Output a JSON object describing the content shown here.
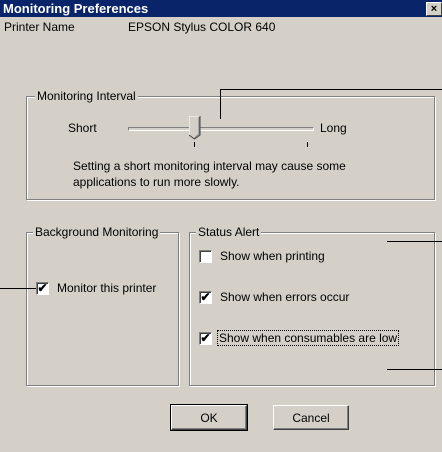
{
  "window": {
    "title": "Monitoring Preferences",
    "close_label": "×"
  },
  "printer": {
    "label": "Printer Name",
    "name": "EPSON Stylus COLOR 640"
  },
  "monitoring_interval": {
    "legend": "Monitoring Interval",
    "min_label": "Short",
    "max_label": "Long",
    "value_fraction": 0.35,
    "note_line1": "Setting a short monitoring interval may cause some",
    "note_line2": "applications to run more slowly."
  },
  "background_monitoring": {
    "legend": "Background Monitoring",
    "monitor_label": "Monitor this printer",
    "monitor_checked": true
  },
  "status_alert": {
    "legend": "Status Alert",
    "items": [
      {
        "label": "Show when printing",
        "checked": false
      },
      {
        "label": "Show when errors occur",
        "checked": true
      },
      {
        "label": "Show when consumables are low",
        "checked": true
      }
    ]
  },
  "buttons": {
    "ok": "OK",
    "cancel": "Cancel"
  }
}
